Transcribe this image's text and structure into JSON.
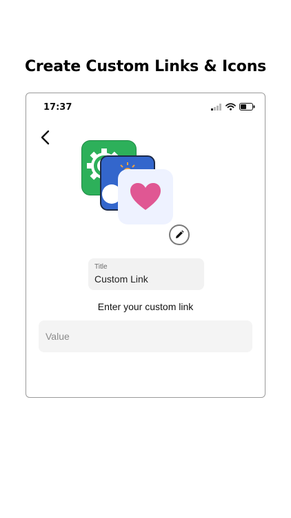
{
  "headline": "Create Custom Links & Icons",
  "status_bar": {
    "time": "17:37",
    "icons": [
      "cellular-signal-icon",
      "wifi-icon",
      "battery-icon"
    ]
  },
  "navigation": {
    "back_icon": "chevron-left-icon"
  },
  "icon_preview": {
    "icons": [
      "gear-app-icon",
      "weather-app-icon",
      "heart-app-icon"
    ],
    "edit_icon": "pencil-icon",
    "colors": {
      "green": "#2db05a",
      "blue": "#3366cc",
      "heart": "#e05793",
      "heart_bg": "#eef2ff"
    }
  },
  "title_field": {
    "label": "Title",
    "value": "Custom Link"
  },
  "link_section": {
    "instruction": "Enter your custom link",
    "placeholder": "Value"
  }
}
